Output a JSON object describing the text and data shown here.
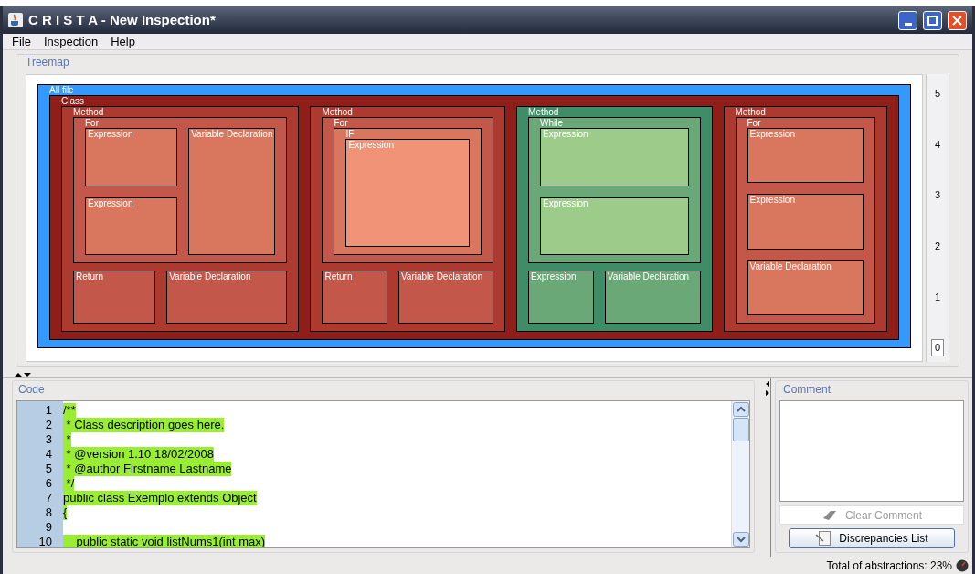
{
  "window": {
    "title": "C R I S T A - New Inspection*"
  },
  "menu": [
    "File",
    "Inspection",
    "Help"
  ],
  "treemap": {
    "title": "Treemap",
    "root": {
      "label": "All file",
      "color": "#3399ff",
      "children": [
        {
          "label": "Class",
          "color": "#8e1e17",
          "children": [
            {
              "label": "Method",
              "color": "#ad3a2e",
              "children": [
                {
                  "label": "For",
                  "color": "#c2574a",
                  "children": [
                    {
                      "label": "Expression",
                      "color": "#d9765e"
                    },
                    {
                      "label": "Expression",
                      "color": "#d9765e"
                    },
                    {
                      "label": "Variable Declaration",
                      "color": "#d9765e"
                    }
                  ]
                },
                {
                  "label": "Return",
                  "color": "#c2574a"
                },
                {
                  "label": "Variable Declaration",
                  "color": "#c2574a"
                }
              ]
            },
            {
              "label": "Method",
              "color": "#ad3a2e",
              "children": [
                {
                  "label": "For",
                  "color": "#c2574a",
                  "children": [
                    {
                      "label": "IF",
                      "color": "#d9765e",
                      "children": [
                        {
                          "label": "Expression",
                          "color": "#f09377"
                        }
                      ]
                    }
                  ]
                },
                {
                  "label": "Return",
                  "color": "#c2574a"
                },
                {
                  "label": "Variable Declaration",
                  "color": "#c2574a"
                }
              ]
            },
            {
              "label": "Method",
              "color": "#3f8d66",
              "children": [
                {
                  "label": "While",
                  "color": "#6aa877",
                  "children": [
                    {
                      "label": "Expression",
                      "color": "#9dcb8a"
                    },
                    {
                      "label": "Expression",
                      "color": "#9dcb8a"
                    }
                  ]
                },
                {
                  "label": "Expression",
                  "color": "#6aa877"
                },
                {
                  "label": "Variable Declaration",
                  "color": "#6aa877"
                }
              ]
            },
            {
              "label": "Method",
              "color": "#ad3a2e",
              "children": [
                {
                  "label": "For",
                  "color": "#c2574a",
                  "children": [
                    {
                      "label": "Expression",
                      "color": "#d9765e"
                    },
                    {
                      "label": "Expression",
                      "color": "#d9765e"
                    },
                    {
                      "label": "Variable Declaration",
                      "color": "#d9765e"
                    }
                  ]
                }
              ]
            }
          ]
        }
      ]
    },
    "scale": [
      {
        "label": "5",
        "selected": false
      },
      {
        "label": "4",
        "selected": false
      },
      {
        "label": "3",
        "selected": false
      },
      {
        "label": "2",
        "selected": false
      },
      {
        "label": "1",
        "selected": false
      },
      {
        "label": "0",
        "selected": true
      }
    ]
  },
  "code": {
    "title": "Code",
    "lines": [
      {
        "number": "1",
        "text": "/**",
        "highlighted": true
      },
      {
        "number": "2",
        "text": " * Class description goes here.",
        "highlighted": true
      },
      {
        "number": "3",
        "text": " *",
        "highlighted": true
      },
      {
        "number": "4",
        "text": " * @version 1.10 18/02/2008",
        "highlighted": true
      },
      {
        "number": "5",
        "text": " * @author Firstname Lastname",
        "highlighted": true
      },
      {
        "number": "6",
        "text": " */",
        "highlighted": true
      },
      {
        "number": "7",
        "text": "public class Exemplo extends Object",
        "highlighted": true
      },
      {
        "number": "8",
        "text": "{",
        "highlighted": true
      },
      {
        "number": "9",
        "highlighted": false
      },
      {
        "number": "10",
        "text": "    public static void listNums1(int max)",
        "highlighted": true
      }
    ]
  },
  "comment": {
    "title": "Comment",
    "clear_button": {
      "label": "Clear Comment",
      "disabled": true
    },
    "list_button": {
      "label": "Discrepancies List"
    }
  },
  "status_bar": {
    "text": "Total of abstractions: 23%"
  }
}
